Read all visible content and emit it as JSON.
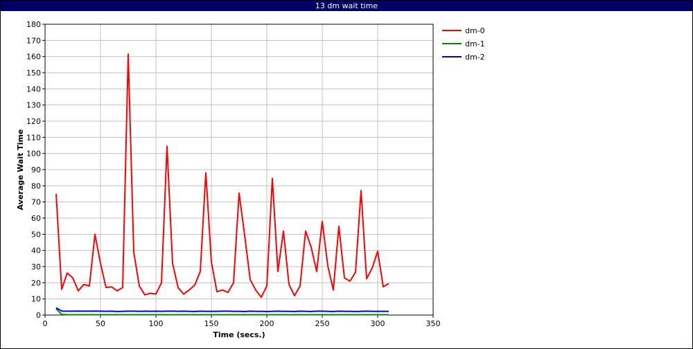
{
  "chart_data": {
    "type": "line",
    "title": "13 dm wait time",
    "xlabel": "Time (secs.)",
    "ylabel": "Average Wait Time",
    "xlim": [
      0,
      350
    ],
    "ylim": [
      0,
      180
    ],
    "xticks": [
      0,
      50,
      100,
      150,
      200,
      250,
      300,
      350
    ],
    "yticks": [
      0,
      10,
      20,
      30,
      40,
      50,
      60,
      70,
      80,
      90,
      100,
      110,
      120,
      130,
      140,
      150,
      160,
      170,
      180
    ],
    "grid": true,
    "legend_position": "top-right",
    "series": [
      {
        "name": "dm-0",
        "color": "#ff0000",
        "x": [
          10,
          15,
          20,
          25,
          30,
          35,
          40,
          45,
          50,
          55,
          60,
          65,
          70,
          75,
          80,
          85,
          90,
          95,
          100,
          105,
          110,
          115,
          120,
          125,
          130,
          135,
          140,
          145,
          150,
          155,
          160,
          165,
          170,
          175,
          180,
          185,
          190,
          195,
          200,
          205,
          210,
          215,
          220,
          225,
          230,
          235,
          240,
          245,
          250,
          255,
          260,
          265,
          270,
          275,
          280,
          285,
          290,
          295,
          300,
          305,
          310
        ],
        "y": [
          75,
          16,
          26,
          23,
          15,
          19,
          18,
          50,
          32,
          17,
          17.5,
          15,
          17,
          161.5,
          39,
          18,
          12.5,
          13.5,
          13,
          20,
          104.5,
          32,
          17,
          13,
          15.5,
          18.5,
          27,
          88,
          33,
          14.5,
          15.5,
          14,
          20,
          75.5,
          49.5,
          22,
          15.5,
          11,
          18,
          84.5,
          27,
          52,
          19,
          12,
          18,
          52,
          42,
          27,
          58,
          30.5,
          15.5,
          55,
          23,
          21,
          26.5,
          77,
          22.5,
          29,
          39.5,
          17.5,
          19.5
        ]
      },
      {
        "name": "dm-1",
        "color": "#008800",
        "x": [
          10,
          15,
          20,
          30,
          40,
          50,
          60,
          70,
          80,
          90,
          100,
          110,
          120,
          130,
          140,
          150,
          160,
          170,
          180,
          190,
          200,
          210,
          220,
          230,
          240,
          250,
          260,
          270,
          280,
          290,
          300,
          310
        ],
        "y": [
          3.8,
          0.4,
          0.2,
          0.2,
          0.2,
          0.2,
          0.2,
          0.2,
          0.2,
          0.2,
          0.2,
          0.2,
          0.2,
          0.2,
          0.2,
          0.2,
          0.2,
          0.2,
          0.2,
          0.2,
          0.2,
          0.2,
          0.2,
          0.2,
          0.2,
          0.2,
          0.2,
          0.2,
          0.2,
          0.2,
          0.2,
          0.2
        ]
      },
      {
        "name": "dm-2",
        "color": "#0000cc",
        "x": [
          10,
          15,
          20,
          25,
          30,
          35,
          40,
          45,
          50,
          55,
          60,
          65,
          70,
          75,
          80,
          85,
          90,
          95,
          100,
          105,
          110,
          115,
          120,
          125,
          130,
          135,
          140,
          145,
          150,
          155,
          160,
          165,
          170,
          175,
          180,
          185,
          190,
          195,
          200,
          205,
          210,
          215,
          220,
          225,
          230,
          235,
          240,
          245,
          250,
          255,
          260,
          265,
          270,
          275,
          280,
          285,
          290,
          295,
          300,
          305,
          310
        ],
        "y": [
          4.5,
          2.5,
          2.4,
          2.4,
          2.5,
          2.4,
          2.4,
          2.5,
          2.4,
          2.3,
          2.4,
          2.2,
          2.3,
          2.4,
          2.4,
          2.3,
          2.4,
          2.3,
          2.4,
          2.3,
          2.4,
          2.4,
          2.3,
          2.4,
          2.3,
          2.2,
          2.4,
          2.3,
          2.3,
          2.3,
          2.4,
          2.4,
          2.3,
          2.3,
          2.2,
          2.4,
          2.3,
          2.3,
          2.2,
          2.3,
          2.4,
          2.3,
          2.3,
          2.2,
          2.4,
          2.3,
          2.2,
          2.4,
          2.4,
          2.3,
          2.2,
          2.4,
          2.3,
          2.3,
          2.2,
          2.3,
          2.4,
          2.3,
          2.3,
          2.3,
          2.3
        ]
      }
    ]
  }
}
